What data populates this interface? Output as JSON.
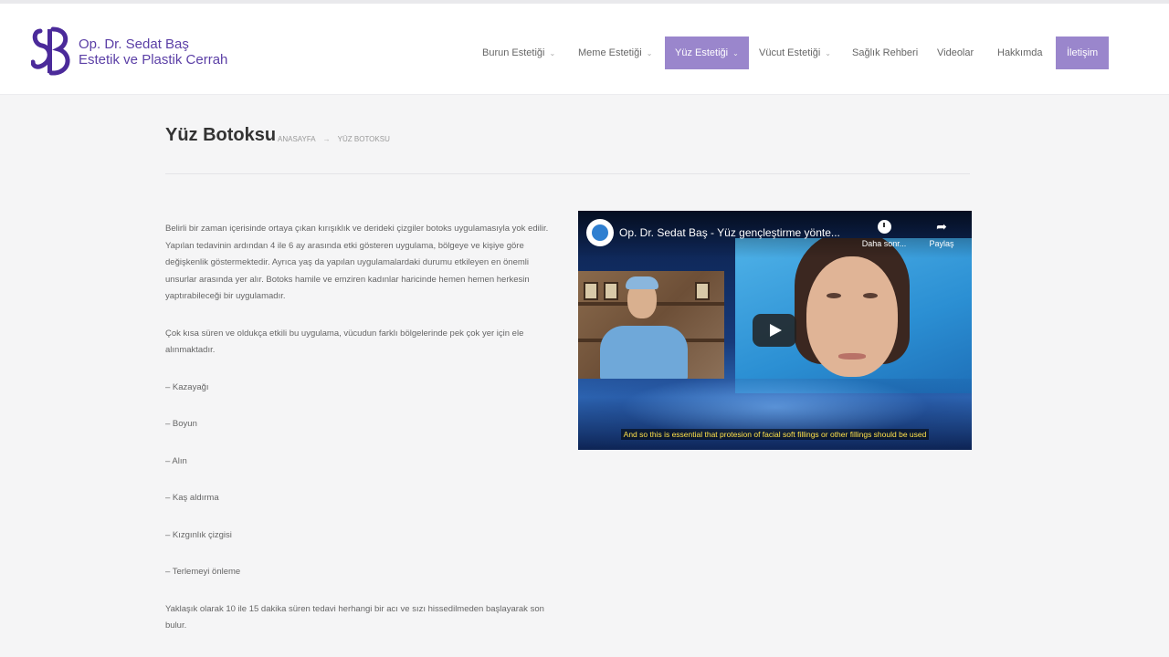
{
  "brand": {
    "name": "Op. Dr. Sedat Baş",
    "subtitle": "Estetik ve Plastik Cerrah",
    "accent_color": "#5b3fa6",
    "nav_highlight_color": "#9a86cc"
  },
  "nav": {
    "items": [
      {
        "label": "Burun Estetiği",
        "has_dropdown": true
      },
      {
        "label": "Meme Estetiği",
        "has_dropdown": true
      },
      {
        "label": "Yüz Estetiği",
        "has_dropdown": true,
        "active": true
      },
      {
        "label": "Vücut Estetiği",
        "has_dropdown": true
      },
      {
        "label": "Sağlık Rehberi",
        "has_dropdown": false
      },
      {
        "label": "Videolar",
        "has_dropdown": false
      },
      {
        "label": "Hakkımda",
        "has_dropdown": false
      },
      {
        "label": "İletişim",
        "has_dropdown": false,
        "highlighted": true
      }
    ],
    "chevron_icon": "chevron-down-icon",
    "chevron_glyph": "⌄"
  },
  "page": {
    "title": "Yüz Botoksu",
    "breadcrumb": {
      "home": "ANASAYFA",
      "separator": "→",
      "current": "YÜZ BOTOKSU"
    }
  },
  "content": {
    "paragraphs": [
      "Belirli bir zaman içerisinde ortaya çıkan kırışıklık ve derideki çizgiler botoks uygulamasıyla yok edilir. Yapılan tedavinin ardından 4 ile 6 ay arasında etki gösteren uygulama, bölgeye ve kişiye göre değişkenlik göstermektedir. Ayrıca yaş da yapılan uygulamalardaki durumu etkileyen en önemli unsurlar arasında yer alır. Botoks hamile ve emziren kadınlar haricinde hemen hemen herkesin yaptırabileceği bir uygulamadır.",
      "Çok kısa süren ve oldukça etkili bu uygulama, vücudun farklı bölgelerinde pek çok yer için ele alınmaktadır."
    ],
    "list_items": [
      "– Kazayağı",
      "– Boyun",
      "– Alın",
      "– Kaş aldırma",
      "– Kızgınlık çizgisi",
      "– Terlemeyi önleme"
    ],
    "closing": "Yaklaşık olarak 10 ile 15 dakika süren tedavi herhangi bir acı ve sızı hissedilmeden başlayarak son bulur."
  },
  "video": {
    "title": "Op. Dr. Sedat Baş - Yüz gençleştirme yönte...",
    "watch_later_label": "Daha sonr...",
    "watch_later_icon": "clock-icon",
    "share_label": "Paylaş",
    "share_icon": "share-arrow-icon",
    "share_glyph": "➦",
    "play_icon": "play-icon",
    "caption": "And so this is essential that protesion of facial soft fillings or other fillings should be used"
  }
}
